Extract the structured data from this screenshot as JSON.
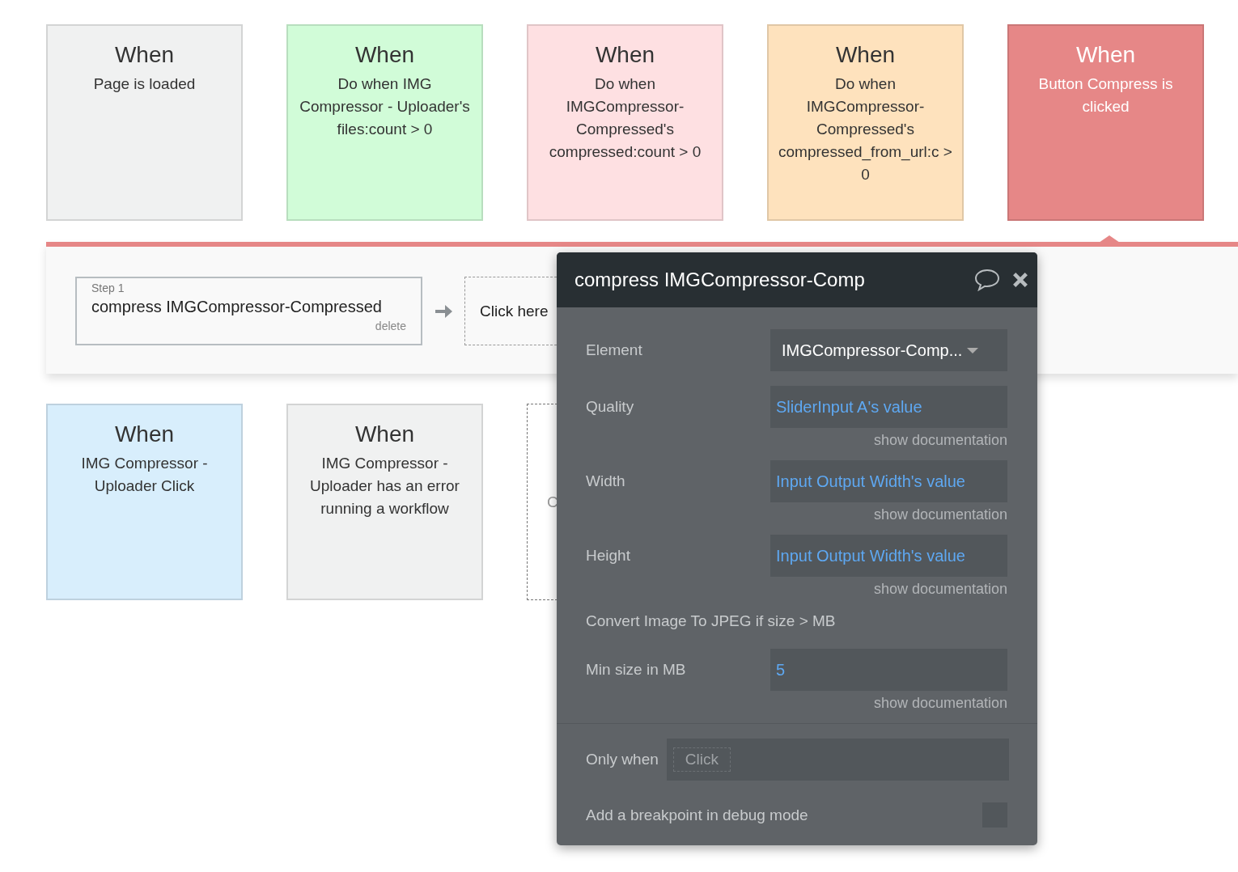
{
  "top_events": [
    {
      "kind": "event",
      "title": "When",
      "description": "Page is loaded",
      "color": "#f0f1f1",
      "selected": false
    },
    {
      "kind": "event",
      "title": "When",
      "description": "Do when IMG Compressor - Uploader's files:count > 0",
      "color": "#d1fcd8",
      "selected": false
    },
    {
      "kind": "event",
      "title": "When",
      "description": "Do when IMGCompressor-Compressed's compressed:count > 0",
      "color": "#fee0e2",
      "selected": false
    },
    {
      "kind": "event",
      "title": "When",
      "description": "Do when IMGCompressor-Compressed's compressed_from_url:c > 0",
      "color": "#fee2bd",
      "selected": false
    },
    {
      "kind": "event",
      "title": "When",
      "description": "Button Compress is clicked",
      "color": "#e68787",
      "selected": true
    }
  ],
  "workflow": {
    "steps": [
      {
        "label": "Step 1",
        "action": "compress IMGCompressor-Compressed",
        "delete": "delete"
      }
    ],
    "add_step": "Click here"
  },
  "bottom_events": [
    {
      "kind": "event",
      "title": "When",
      "description": "IMG Compressor - Uploader Click",
      "color": "#d8eefc",
      "selected": false
    },
    {
      "kind": "event",
      "title": "When",
      "description": "IMG Compressor - Uploader has an error running a workflow",
      "color": "#f0f1f1",
      "selected": false
    },
    {
      "kind": "placeholder",
      "description": "C"
    }
  ],
  "popup": {
    "title": "compress IMGCompressor-Comp",
    "fields": [
      {
        "kind": "dropdown",
        "label": "Element",
        "value": "IMGCompressor-Comp..."
      },
      {
        "kind": "expression",
        "label": "Quality",
        "value": "SliderInput A's value",
        "doc": "show documentation"
      },
      {
        "kind": "expression",
        "label": "Width",
        "value": "Input Output Width's value",
        "doc": "show documentation"
      },
      {
        "kind": "expression",
        "label": "Height",
        "value": "Input Output Width's value",
        "doc": "show documentation"
      },
      {
        "kind": "heading",
        "label": "Convert Image To JPEG if size > MB"
      },
      {
        "kind": "expression",
        "label": "Min size in MB",
        "value": "5",
        "doc": "show documentation"
      }
    ],
    "only_when": {
      "label": "Only when",
      "placeholder": "Click"
    },
    "breakpoint": {
      "label": "Add a breakpoint in debug mode",
      "checked": false
    }
  }
}
